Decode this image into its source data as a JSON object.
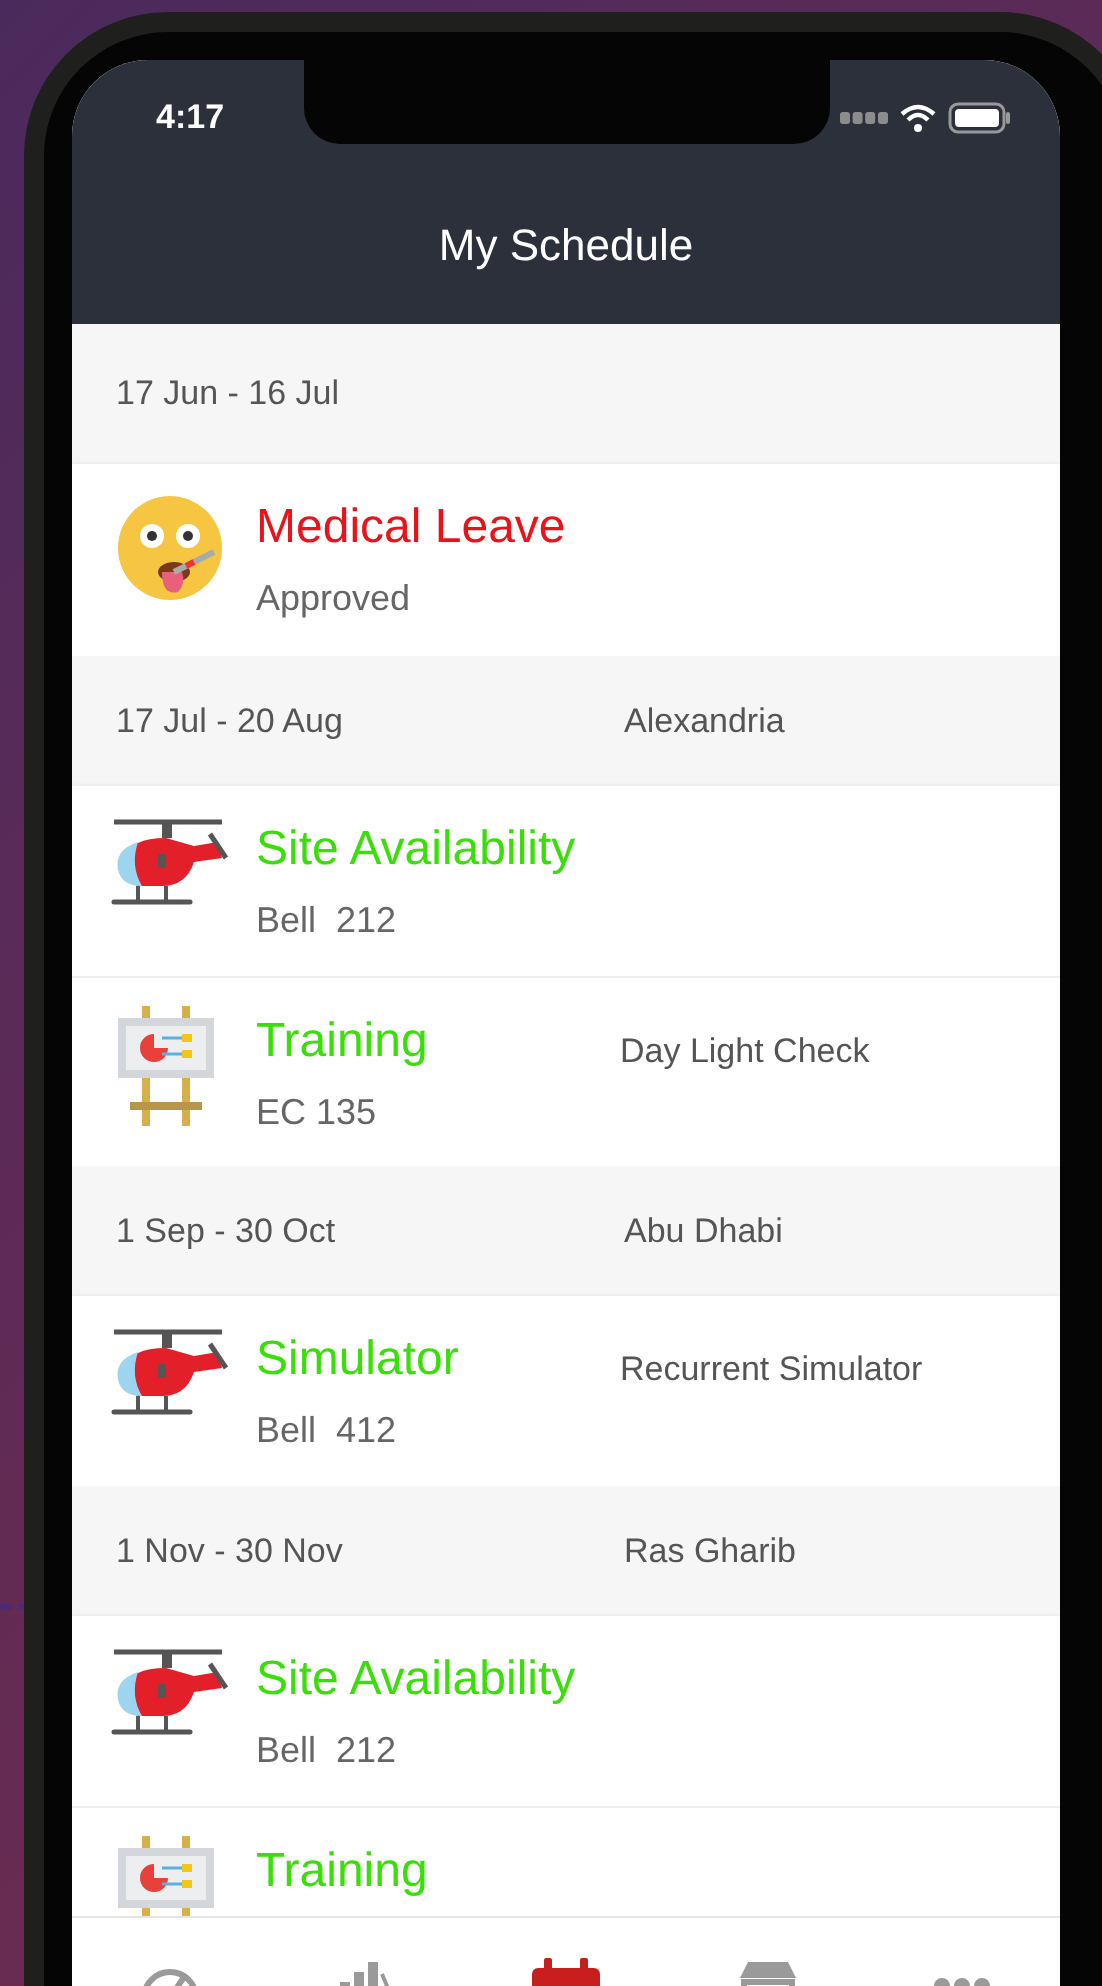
{
  "status_bar": {
    "time": "4:17"
  },
  "header": {
    "title": "My Schedule"
  },
  "groups": [
    {
      "dates": "17 Jun - 16 Jul",
      "entries": [
        {
          "kind": "leave",
          "title": "Medical Leave",
          "subtitle": "Approved",
          "color": "#e8141b"
        }
      ]
    },
    {
      "dates": "17 Jul - 20 Aug",
      "location": "Alexandria",
      "entries": [
        {
          "kind": "helicopter",
          "title": "Site Availability",
          "subtitle": "Bell  212",
          "color": "#3ade08"
        },
        {
          "kind": "training",
          "title": "Training",
          "subtitle": "EC 135",
          "note": "Day Light Check",
          "color": "#3ade08"
        }
      ]
    },
    {
      "dates": "1 Sep - 30 Oct",
      "location": "Abu Dhabi",
      "entries": [
        {
          "kind": "helicopter",
          "title": "Simulator",
          "subtitle": "Bell  412",
          "note": "Recurrent Simulator",
          "color": "#3ade08"
        }
      ]
    },
    {
      "dates": "1 Nov - 30 Nov",
      "location": "Ras Gharib",
      "entries": [
        {
          "kind": "helicopter",
          "title": "Site Availability",
          "subtitle": "Bell  212",
          "color": "#3ade08"
        },
        {
          "kind": "training",
          "title": "Training",
          "color": "#3ade08"
        }
      ]
    }
  ],
  "tab_bar": [
    {
      "kind": "gauge",
      "selected": false
    },
    {
      "kind": "chart",
      "selected": false
    },
    {
      "kind": "calendar",
      "selected": true
    },
    {
      "kind": "shop",
      "selected": false
    },
    {
      "kind": "more",
      "selected": false
    }
  ]
}
